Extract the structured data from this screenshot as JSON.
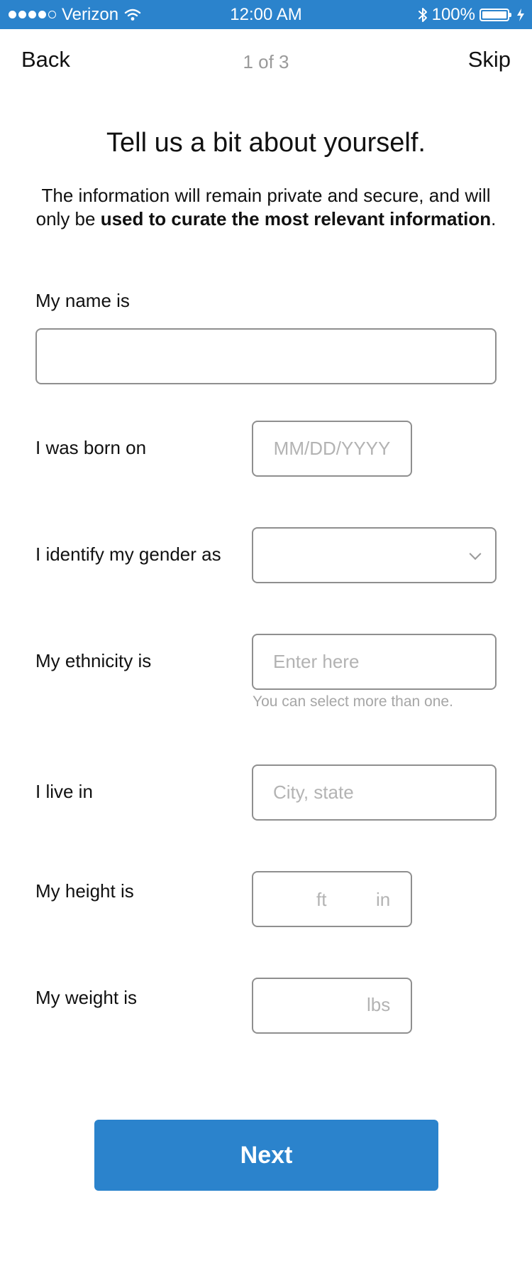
{
  "status_bar": {
    "carrier": "Verizon",
    "time": "12:00 AM",
    "battery": "100%",
    "signal_bars_filled": 4,
    "signal_bars_total": 5,
    "background": "#2b83cc"
  },
  "nav": {
    "back_label": "Back",
    "step_label": "1 of 3",
    "skip_label": "Skip"
  },
  "title": "Tell us a bit about yourself.",
  "intro": {
    "line1": "The information will remain private and secure, and will",
    "line2_prefix": "only be ",
    "line2_bold": "used to curate the most relevant information",
    "line2_suffix": "."
  },
  "form": {
    "name": {
      "label": "My name is",
      "value": "",
      "placeholder": ""
    },
    "birth": {
      "label": "I was born on",
      "placeholder": "MM/DD/YYYY"
    },
    "gender": {
      "label": "I identify my gender as",
      "selected": "",
      "icon": "chevron-down-icon"
    },
    "ethnicity": {
      "label": "My ethnicity is",
      "placeholder": "Enter here",
      "helper": "You can select more than one."
    },
    "location": {
      "label": "I live in",
      "placeholder": "City, state"
    },
    "height": {
      "label": "My height is",
      "ft_unit": "ft",
      "in_unit": "in"
    },
    "weight": {
      "label": "My weight is",
      "unit": "lbs"
    }
  },
  "next_button": {
    "label": "Next",
    "color": "#2b83cc"
  }
}
